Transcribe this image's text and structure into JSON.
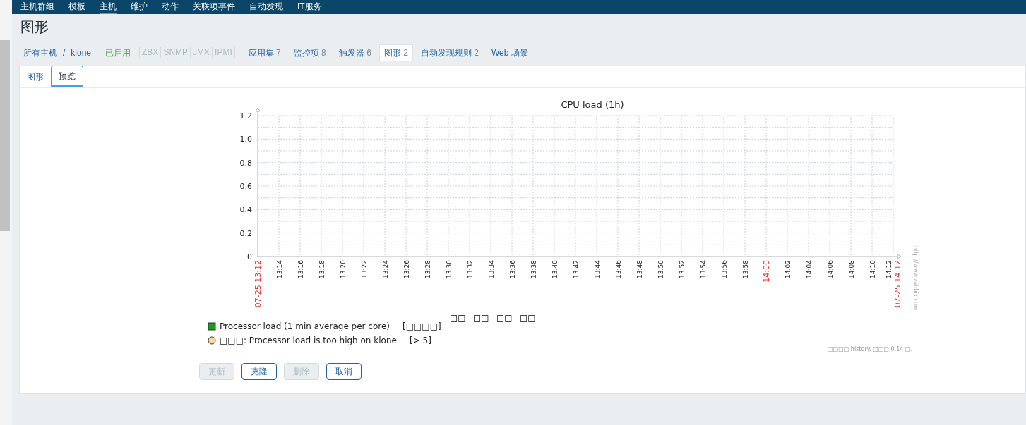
{
  "top_nav": {
    "items": [
      {
        "label": "主机群组",
        "selected": false
      },
      {
        "label": "模板",
        "selected": false
      },
      {
        "label": "主机",
        "selected": true
      },
      {
        "label": "维护",
        "selected": false
      },
      {
        "label": "动作",
        "selected": false
      },
      {
        "label": "关联项事件",
        "selected": false
      },
      {
        "label": "自动发现",
        "selected": false
      },
      {
        "label": "IT服务",
        "selected": false
      }
    ]
  },
  "page_title": "图形",
  "host_bar": {
    "breadcrumb": [
      "所有主机",
      "klone"
    ],
    "separator": "/",
    "status": "已启用",
    "availability": [
      {
        "label": "ZBX",
        "on": false
      },
      {
        "label": "SNMP",
        "on": false
      },
      {
        "label": "JMX",
        "on": false
      },
      {
        "label": "IPMI",
        "on": false
      }
    ],
    "tabs": [
      {
        "label": "应用集",
        "count": "7",
        "selected": false
      },
      {
        "label": "监控项",
        "count": "8",
        "selected": false
      },
      {
        "label": "触发器",
        "count": "6",
        "selected": false
      },
      {
        "label": "图形",
        "count": "2",
        "selected": true
      },
      {
        "label": "自动发现规则",
        "count": "2",
        "selected": false
      },
      {
        "label": "Web 场景",
        "selected": false
      }
    ]
  },
  "sub_tabs": [
    {
      "label": "图形",
      "selected": false
    },
    {
      "label": "预览",
      "selected": true
    }
  ],
  "graph": {
    "chart_data": {
      "type": "line",
      "title": "CPU load (1h)",
      "ylim": [
        0,
        1.2
      ],
      "categories": [
        "07-25 13:12",
        "13:14",
        "13:16",
        "13:18",
        "13:20",
        "13:22",
        "13:24",
        "13:26",
        "13:28",
        "13:30",
        "13:32",
        "13:34",
        "13:36",
        "13:38",
        "13:40",
        "13:42",
        "13:44",
        "13:46",
        "13:48",
        "13:50",
        "13:52",
        "13:54",
        "13:56",
        "13:58",
        "14:00",
        "14:02",
        "14:04",
        "14:06",
        "14:08",
        "14:10",
        "14:12"
      ],
      "annotations": [
        "07-25 14:12"
      ],
      "grid": true,
      "yticks": [
        {
          "value": 0,
          "label": "0"
        },
        {
          "value": 0.2,
          "label": "0.2"
        },
        {
          "value": 0.4,
          "label": "0.4"
        },
        {
          "value": 0.6,
          "label": "0.6"
        },
        {
          "value": 0.8,
          "label": "0.8"
        },
        {
          "value": 1.0,
          "label": "1.0"
        },
        {
          "value": 1.2,
          "label": "1.2"
        }
      ]
    },
    "x_label_states": [
      {
        "highlighted": true
      },
      {
        "highlighted": false
      },
      {
        "highlighted": false
      },
      {
        "highlighted": false
      },
      {
        "highlighted": false
      },
      {
        "highlighted": false
      },
      {
        "highlighted": false
      },
      {
        "highlighted": false
      },
      {
        "highlighted": false
      },
      {
        "highlighted": false
      },
      {
        "highlighted": false
      },
      {
        "highlighted": false
      },
      {
        "highlighted": false
      },
      {
        "highlighted": false
      },
      {
        "highlighted": false
      },
      {
        "highlighted": false
      },
      {
        "highlighted": false
      },
      {
        "highlighted": false
      },
      {
        "highlighted": false
      },
      {
        "highlighted": false
      },
      {
        "highlighted": false
      },
      {
        "highlighted": false
      },
      {
        "highlighted": false
      },
      {
        "highlighted": false
      },
      {
        "highlighted": true
      },
      {
        "highlighted": false
      },
      {
        "highlighted": false
      },
      {
        "highlighted": false
      },
      {
        "highlighted": false
      },
      {
        "highlighted": false
      },
      {
        "highlighted": false
      }
    ],
    "watermark_url": "http://www.zabbix.com",
    "legend_headers": [
      "□□",
      "□□",
      "□□",
      "□□"
    ],
    "legend": [
      {
        "kind": "item",
        "label": "Processor load (1 min average per core)",
        "value": "[□□□□]",
        "color": "#1a9c1a"
      },
      {
        "kind": "trigger",
        "label": "□□□: Processor load is too high on klone",
        "value": "[> 5]",
        "color": "#ffd899"
      }
    ],
    "footer_note": "□□□□ history. □□□ 0.14 □."
  },
  "buttons": [
    {
      "label": "更新",
      "disabled": true
    },
    {
      "label": "克隆",
      "disabled": false
    },
    {
      "label": "删除",
      "disabled": true
    },
    {
      "label": "取消",
      "disabled": false
    }
  ]
}
